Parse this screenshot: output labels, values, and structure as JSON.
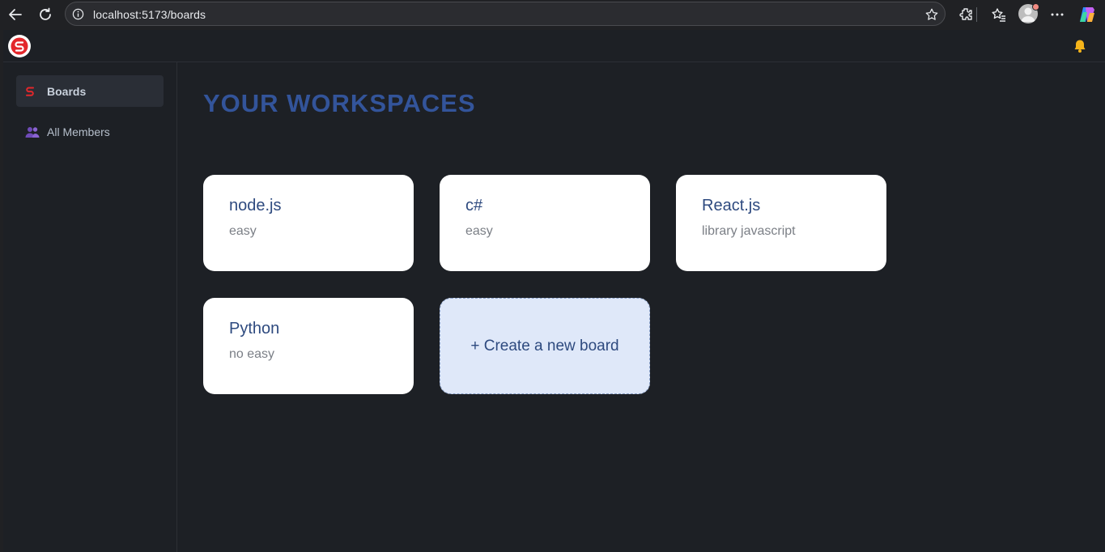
{
  "browser": {
    "url": "localhost:5173/boards"
  },
  "sidebar": {
    "items": [
      {
        "label": "Boards",
        "icon": "app-logo-icon",
        "active": true
      },
      {
        "label": "All Members",
        "icon": "members-icon",
        "active": false
      }
    ]
  },
  "main": {
    "title": "YOUR WORKSPACES",
    "boards": [
      {
        "name": "node.js",
        "description": "easy"
      },
      {
        "name": "c#",
        "description": "easy"
      },
      {
        "name": "React.js",
        "description": "library javascript"
      },
      {
        "name": "Python",
        "description": "no easy"
      }
    ],
    "create_label": "+ Create a new board"
  },
  "colors": {
    "accent": "#33549a",
    "logo_red": "#e3272b",
    "card_background": "#ffffff",
    "create_card_background": "#dfe8f9",
    "app_background": "#1d2025"
  }
}
